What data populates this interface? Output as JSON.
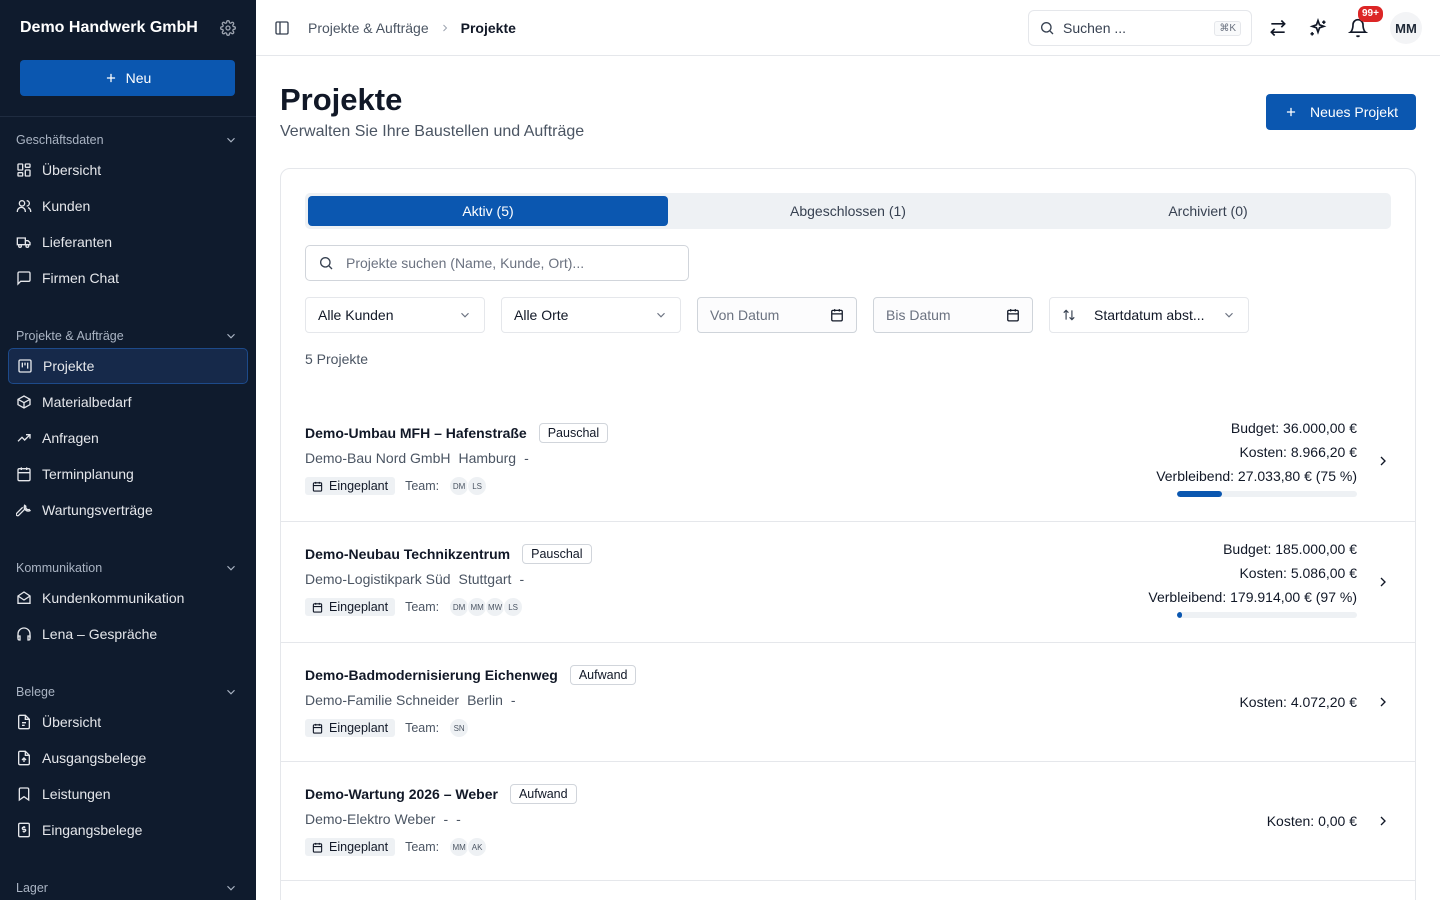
{
  "sidebar": {
    "company": "Demo Handwerk GmbH",
    "new_label": "Neu",
    "sections": [
      {
        "title": "Geschäftsdaten",
        "items": [
          {
            "label": "Übersicht",
            "icon": "grid-icon"
          },
          {
            "label": "Kunden",
            "icon": "users-icon"
          },
          {
            "label": "Lieferanten",
            "icon": "truck-icon"
          },
          {
            "label": "Firmen Chat",
            "icon": "message-icon"
          }
        ]
      },
      {
        "title": "Projekte & Aufträge",
        "items": [
          {
            "label": "Projekte",
            "icon": "kanban-icon",
            "active": true
          },
          {
            "label": "Materialbedarf",
            "icon": "package-icon"
          },
          {
            "label": "Anfragen",
            "icon": "trending-icon"
          },
          {
            "label": "Terminplanung",
            "icon": "calendar-icon"
          },
          {
            "label": "Wartungsverträge",
            "icon": "wrench-icon"
          }
        ]
      },
      {
        "title": "Kommunikation",
        "items": [
          {
            "label": "Kundenkommunikation",
            "icon": "mail-open-icon"
          },
          {
            "label": "Lena – Gespräche",
            "icon": "headphones-icon"
          }
        ]
      },
      {
        "title": "Belege",
        "items": [
          {
            "label": "Übersicht",
            "icon": "file-icon"
          },
          {
            "label": "Ausgangsbelege",
            "icon": "file-out-icon"
          },
          {
            "label": "Leistungen",
            "icon": "bookmark-icon"
          },
          {
            "label": "Eingangsbelege",
            "icon": "receipt-icon"
          }
        ]
      },
      {
        "title": "Lager",
        "items": []
      }
    ]
  },
  "topbar": {
    "breadcrumb": [
      "Projekte & Aufträge",
      "Projekte"
    ],
    "search_placeholder": "Suchen ...",
    "search_shortcut": "⌘K",
    "notification_count": "99+",
    "user_initials": "MM"
  },
  "page": {
    "title": "Projekte",
    "subtitle": "Verwalten Sie Ihre Baustellen und Aufträge",
    "new_button": "Neues Projekt",
    "tabs": [
      {
        "label": "Aktiv (5)",
        "active": true
      },
      {
        "label": "Abgeschlossen (1)",
        "active": false
      },
      {
        "label": "Archiviert (0)",
        "active": false
      }
    ],
    "search_placeholder": "Projekte suchen (Name, Kunde, Ort)...",
    "filters": {
      "customers": "Alle Kunden",
      "places": "Alle Orte",
      "from_date": "Von Datum",
      "to_date": "Bis Datum",
      "sort": "Startdatum abst..."
    },
    "count": "5 Projekte",
    "projects": [
      {
        "name": "Demo-Umbau MFH – Hafenstraße",
        "type": "Pauschal",
        "customer": "Demo-Bau Nord GmbH",
        "city": "Hamburg",
        "extra": "-",
        "status": "Eingeplant",
        "team_label": "Team:",
        "team": [
          "DM",
          "LS"
        ],
        "budget": "Budget: 36.000,00 €",
        "costs": "Kosten: 8.966,20 €",
        "remaining": "Verbleibend: 27.033,80 € (75 %)",
        "spent_percent": 25
      },
      {
        "name": "Demo-Neubau Technikzentrum",
        "type": "Pauschal",
        "customer": "Demo-Logistikpark Süd",
        "city": "Stuttgart",
        "extra": "-",
        "status": "Eingeplant",
        "team_label": "Team:",
        "team": [
          "DM",
          "MM",
          "MW",
          "LS"
        ],
        "budget": "Budget: 185.000,00 €",
        "costs": "Kosten: 5.086,00 €",
        "remaining": "Verbleibend: 179.914,00 € (97 %)",
        "spent_percent": 3
      },
      {
        "name": "Demo-Badmodernisierung Eichenweg",
        "type": "Aufwand",
        "customer": "Demo-Familie Schneider",
        "city": "Berlin",
        "extra": "-",
        "status": "Eingeplant",
        "team_label": "Team:",
        "team": [
          "SN"
        ],
        "costs": "Kosten: 4.072,20 €"
      },
      {
        "name": "Demo-Wartung 2026 – Weber",
        "type": "Aufwand",
        "customer": "Demo-Elektro Weber",
        "city": "-",
        "extra": "-",
        "status": "Eingeplant",
        "team_label": "Team:",
        "team": [
          "MM",
          "AK"
        ],
        "costs": "Kosten: 0,00 €"
      }
    ]
  }
}
